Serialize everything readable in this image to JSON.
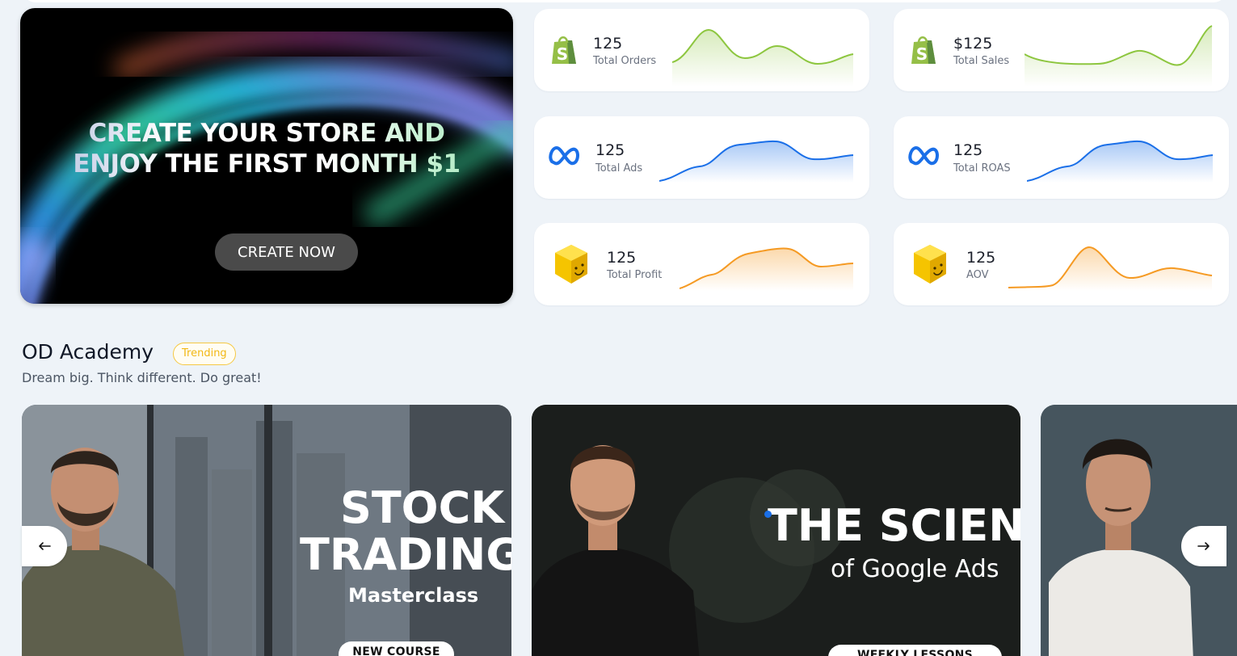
{
  "promo": {
    "headline_line1": "CREATE YOUR STORE AND",
    "headline_line2": "ENJOY THE FIRST MONTH $1",
    "button_label": "CREATE NOW"
  },
  "stats": [
    {
      "value": "125",
      "label": "Total Orders",
      "icon": "shopify-icon",
      "color": "#8dc63f"
    },
    {
      "value": "$125",
      "label": "Total Sales",
      "icon": "shopify-icon",
      "color": "#8dc63f"
    },
    {
      "value": "125",
      "label": "Total Ads",
      "icon": "meta-icon",
      "color": "#1a6fe8"
    },
    {
      "value": "125",
      "label": "Total ROAS",
      "icon": "meta-icon",
      "color": "#1a6fe8"
    },
    {
      "value": "125",
      "label": "Total Profit",
      "icon": "smiley-cube-icon",
      "color": "#f59a23"
    },
    {
      "value": "125",
      "label": "AOV",
      "icon": "smiley-cube-icon",
      "color": "#f59a23"
    }
  ],
  "academy": {
    "title": "OD Academy",
    "badge": "Trending",
    "subtitle": "Dream big. Think different. Do great!",
    "courses": [
      {
        "title_line1": "STOCK",
        "title_line2": "TRADING",
        "subtitle": "Masterclass",
        "pill": "NEW COURSE"
      },
      {
        "title_line1": "THE SCIENC",
        "subtitle": "of Google Ads",
        "pill": "WEEKLY LESSONS"
      },
      {
        "title_line1": "",
        "subtitle": "",
        "pill": ""
      }
    ],
    "prev_icon": "arrow-left-icon",
    "next_icon": "arrow-right-icon"
  }
}
